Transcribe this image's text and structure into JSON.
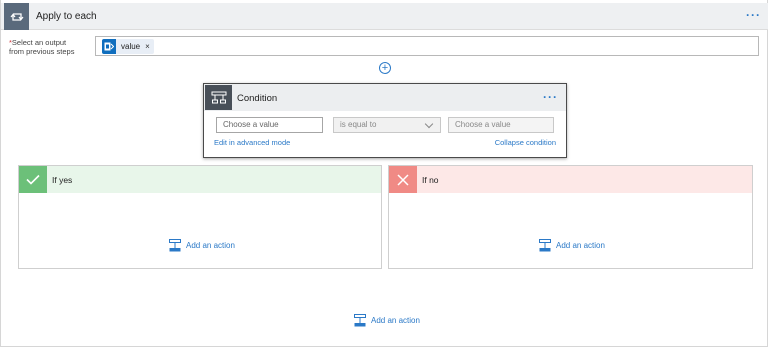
{
  "apply_each": {
    "title": "Apply to each"
  },
  "select_output": {
    "required_mark": "*",
    "label_line1": "Select an output",
    "label_line2": "from previous steps",
    "token_text": "value",
    "token_remove": "×"
  },
  "condition": {
    "title": "Condition",
    "left_placeholder": "Choose a value",
    "operator": "is equal to",
    "right_placeholder": "Choose a value",
    "edit_advanced": "Edit in advanced mode",
    "collapse": "Collapse condition"
  },
  "branches": {
    "yes": {
      "title": "If yes",
      "add_action": "Add an action"
    },
    "no": {
      "title": "If no",
      "add_action": "Add an action"
    }
  },
  "main": {
    "add_action": "Add an action"
  },
  "icons": {
    "loop": "loop-icon",
    "condition": "condition-icon",
    "check": "check-icon",
    "close": "close-icon",
    "add_action": "add-action-icon",
    "token": "outlook-icon",
    "plus": "plus-icon",
    "more": "more-icon"
  },
  "colors": {
    "accent": "#2b79c7",
    "yes": "#6cc079",
    "no": "#f08a85",
    "loop_header": "#5a6a7c"
  }
}
